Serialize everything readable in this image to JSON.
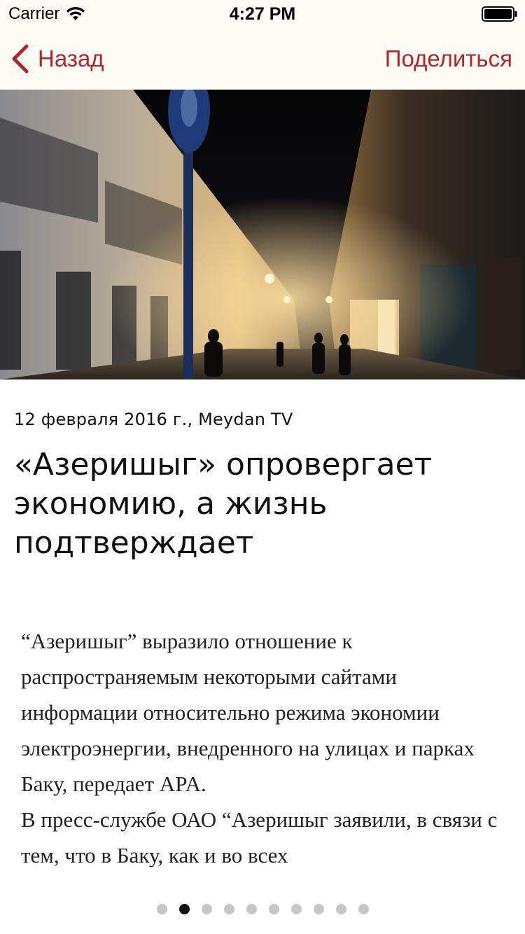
{
  "status_bar": {
    "carrier": "Carrier",
    "time": "4:27 PM"
  },
  "nav": {
    "back_label": "Назад",
    "share_label": "Поделиться",
    "accent_color": "#b5242c"
  },
  "article": {
    "meta": "12 февраля 2016 г., Meydan TV",
    "title": "«Азеришыг» опровергает экономию, а жизнь подтверждает",
    "paragraphs": [
      "“Азеришыг” выразило отношение к распространяемым некоторыми сайтами информации относительно режима экономии электроэнергии, внедренного на улицах и парках Баку, передает APA.",
      "В пресс-службе ОАО “Азеришыг заявили, в связи с тем, что в Баку, как и во всех"
    ]
  },
  "pager": {
    "total": 10,
    "current": 2
  }
}
